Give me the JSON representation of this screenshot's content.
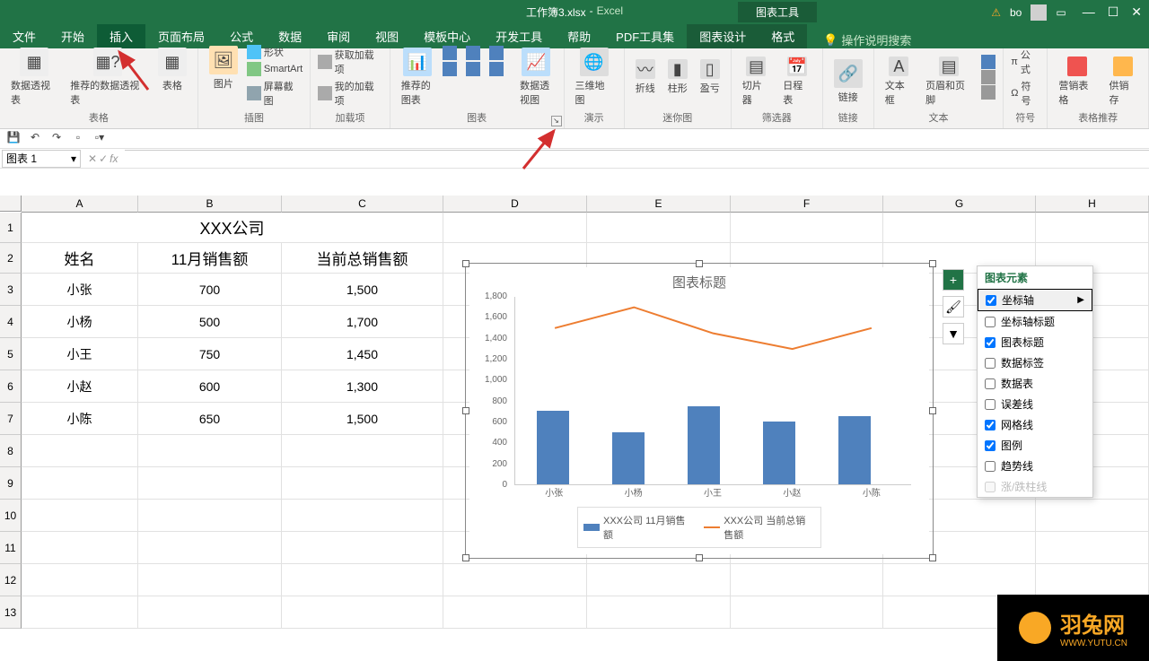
{
  "title_bar": {
    "filename": "工作簿3.xlsx",
    "app": "Excel",
    "chart_tools": "图表工具",
    "user": "bo"
  },
  "tabs": {
    "items": [
      "文件",
      "开始",
      "插入",
      "页面布局",
      "公式",
      "数据",
      "审阅",
      "视图",
      "模板中心",
      "开发工具",
      "帮助",
      "PDF工具集",
      "图表设计",
      "格式"
    ],
    "active_index": 2,
    "search": "操作说明搜索"
  },
  "ribbon_groups": {
    "tables": {
      "pivot": "数据透视表",
      "recommended": "推荐的数据透视表",
      "table": "表格",
      "label": "表格"
    },
    "illustrations": {
      "picture": "图片",
      "shapes": "形状",
      "smartart": "SmartArt",
      "screenshot": "屏幕截图",
      "label": "插图"
    },
    "addins": {
      "get": "获取加载项",
      "my": "我的加载项",
      "label": "加载项"
    },
    "charts": {
      "recommended": "推荐的图表",
      "pivot_chart": "数据透视图",
      "label": "图表"
    },
    "tours": {
      "map": "三维地图",
      "label": "演示"
    },
    "sparklines": {
      "line": "折线",
      "column": "柱形",
      "winloss": "盈亏",
      "label": "迷你图"
    },
    "filters": {
      "slicer": "切片器",
      "timeline": "日程表",
      "label": "筛选器"
    },
    "links": {
      "link": "链接",
      "label": "链接"
    },
    "text": {
      "textbox": "文本框",
      "header": "页眉和页脚",
      "label": "文本"
    },
    "symbols": {
      "equation": "公式",
      "symbol": "符号",
      "label": "符号"
    },
    "table_rec": {
      "sales": "营销表格",
      "supply": "供销存",
      "label": "表格推荐"
    }
  },
  "namebox": "图表 1",
  "columns": [
    "A",
    "B",
    "C",
    "D",
    "E",
    "F",
    "G",
    "H"
  ],
  "row_count": 13,
  "spreadsheet": {
    "company": "XXX公司",
    "headers": {
      "name": "姓名",
      "nov": "11月销售额",
      "total": "当前总销售额"
    },
    "rows": [
      {
        "name": "小张",
        "nov": "700",
        "total": "1,500"
      },
      {
        "name": "小杨",
        "nov": "500",
        "total": "1,700"
      },
      {
        "name": "小王",
        "nov": "750",
        "total": "1,450"
      },
      {
        "name": "小赵",
        "nov": "600",
        "total": "1,300"
      },
      {
        "name": "小陈",
        "nov": "650",
        "total": "1,500"
      }
    ]
  },
  "chart": {
    "title": "图表标题",
    "legend1": "XXX公司 11月销售额",
    "legend2": "XXX公司 当前总销售额"
  },
  "chart_data": {
    "type": "bar",
    "categories": [
      "小张",
      "小杨",
      "小王",
      "小赵",
      "小陈"
    ],
    "series": [
      {
        "name": "XXX公司 11月销售额",
        "type": "bar",
        "values": [
          700,
          500,
          750,
          600,
          650
        ],
        "color": "#4f81bd"
      },
      {
        "name": "XXX公司 当前总销售额",
        "type": "line",
        "values": [
          1500,
          1700,
          1450,
          1300,
          1500
        ],
        "color": "#ed7d31"
      }
    ],
    "title": "图表标题",
    "y_ticks": [
      0,
      200,
      400,
      600,
      800,
      1000,
      1200,
      1400,
      1600,
      1800
    ],
    "ylim": [
      0,
      1800
    ]
  },
  "elements_popup": {
    "title": "图表元素",
    "items": [
      {
        "label": "坐标轴",
        "checked": true,
        "selected": true,
        "has_sub": true
      },
      {
        "label": "坐标轴标题",
        "checked": false
      },
      {
        "label": "图表标题",
        "checked": true
      },
      {
        "label": "数据标签",
        "checked": false
      },
      {
        "label": "数据表",
        "checked": false
      },
      {
        "label": "误差线",
        "checked": false
      },
      {
        "label": "网格线",
        "checked": true
      },
      {
        "label": "图例",
        "checked": true
      },
      {
        "label": "趋势线",
        "checked": false
      },
      {
        "label": "涨/跌柱线",
        "checked": false,
        "disabled": true
      }
    ]
  },
  "watermark": {
    "name": "羽兔网",
    "url": "WWW.YUTU.CN"
  }
}
